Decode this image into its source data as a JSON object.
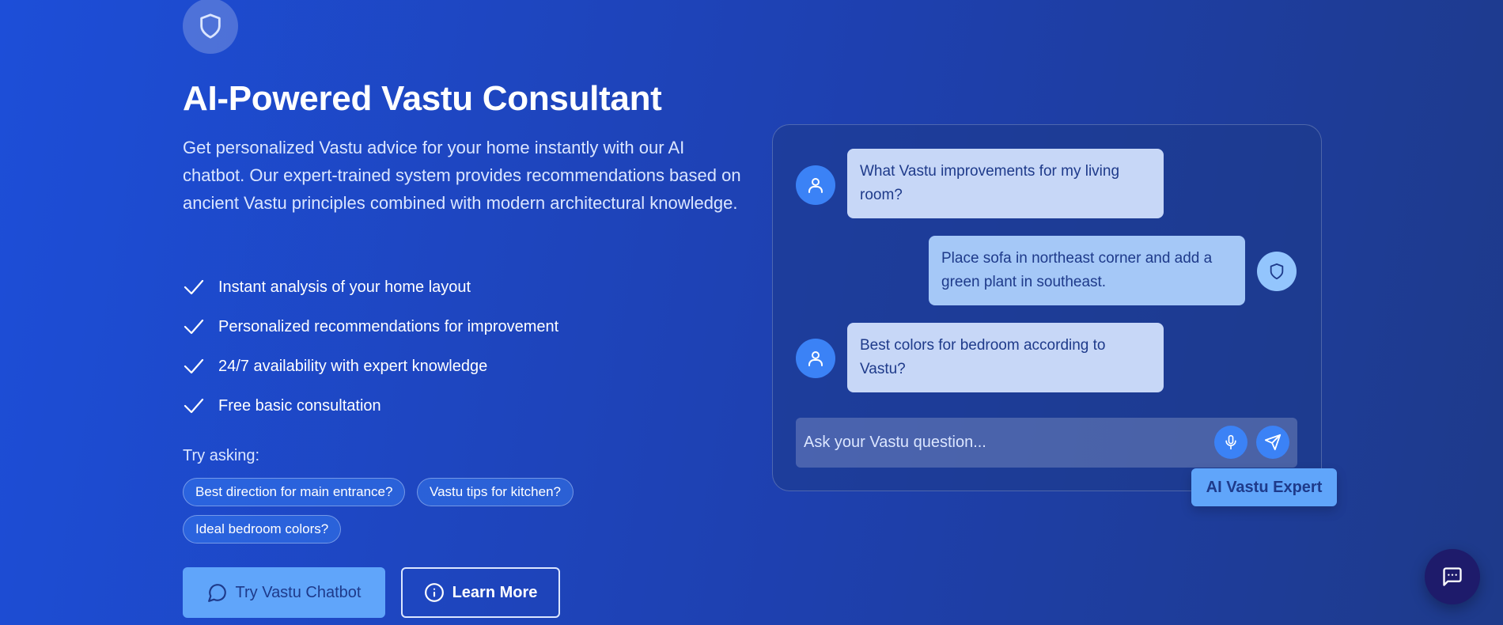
{
  "hero": {
    "title": "AI-Powered Vastu Consultant",
    "description": "Get personalized Vastu advice for your home instantly with our AI chatbot. Our expert-trained system provides recommendations based on ancient Vastu principles combined with modern architectural knowledge.",
    "icon": "shield-icon"
  },
  "features": [
    "Instant analysis of your home layout",
    "Personalized recommendations for improvement",
    "24/7 availability with expert knowledge",
    "Free basic consultation"
  ],
  "suggestions": {
    "label": "Try asking:",
    "chips": [
      "Best direction for main entrance?",
      "Vastu tips for kitchen?",
      "Ideal bedroom colors?"
    ]
  },
  "buttons": {
    "primary": "Try Vastu Chatbot",
    "secondary": "Learn More"
  },
  "chat": {
    "messages": [
      {
        "sender": "user",
        "text": "What Vastu improvements for my living room?"
      },
      {
        "sender": "bot",
        "text": "Place sofa in northeast corner and add a green plant in southeast."
      },
      {
        "sender": "user",
        "text": "Best colors for bedroom according to Vastu?"
      }
    ],
    "input_placeholder": "Ask your Vastu question...",
    "badge": "AI Vastu Expert"
  },
  "colors": {
    "accent": "#60a5fa",
    "background": "#1d4ed8",
    "dark": "#1e3a8a",
    "fab": "#1e1b6b"
  }
}
